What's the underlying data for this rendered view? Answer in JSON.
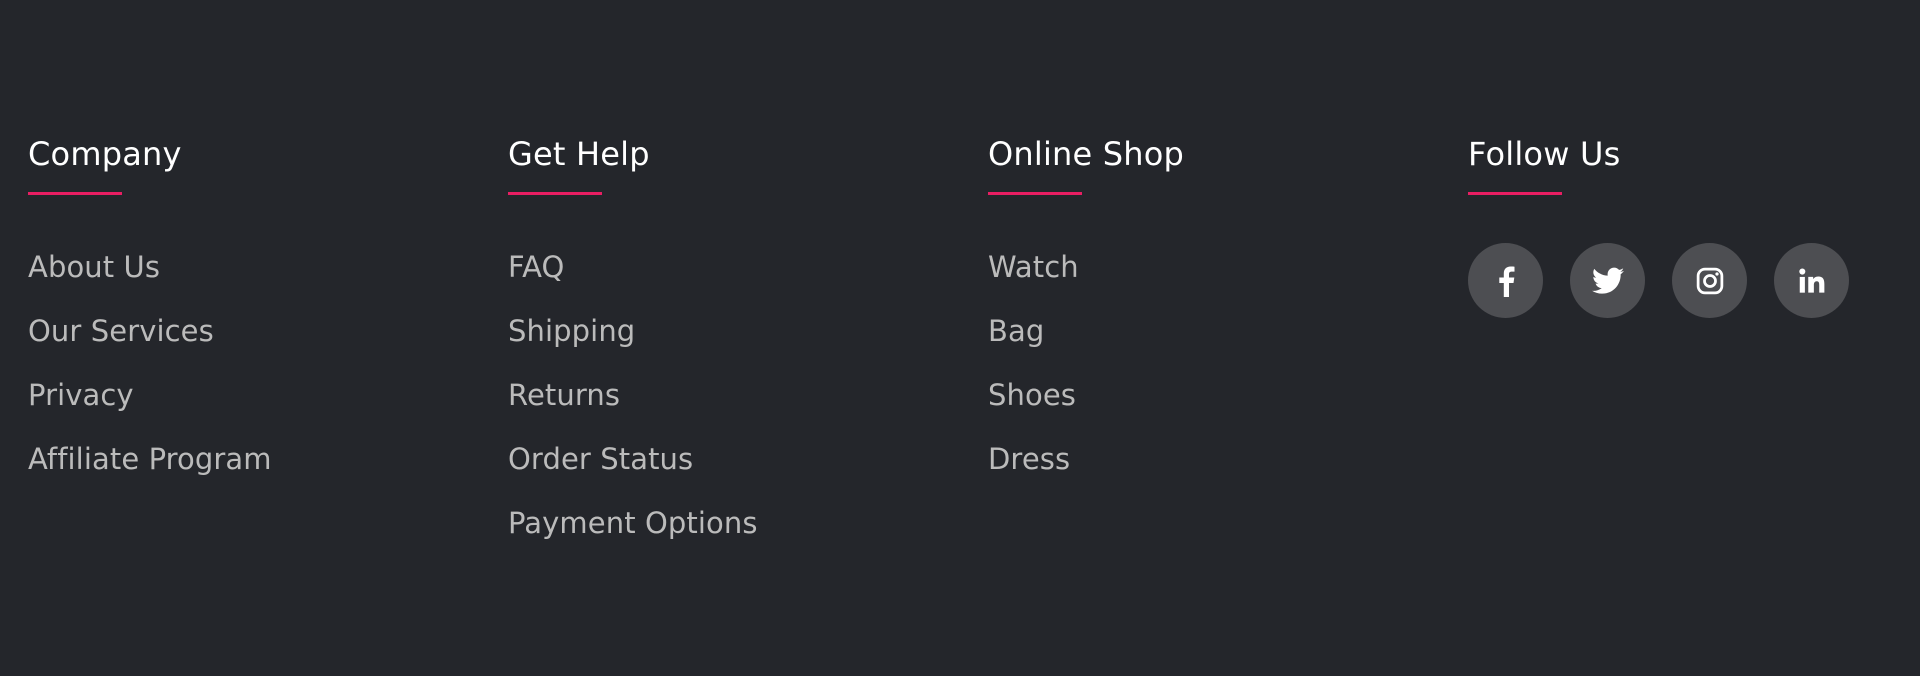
{
  "colors": {
    "background": "#24262b",
    "accent": "#e91e63",
    "heading": "#ffffff",
    "link": "#bbbbbb",
    "social_button_bg": "#4d4e52"
  },
  "footer": {
    "columns": [
      {
        "title": "Company",
        "links": [
          "About Us",
          "Our Services",
          "Privacy",
          "Affiliate Program"
        ]
      },
      {
        "title": "Get Help",
        "links": [
          "FAQ",
          "Shipping",
          "Returns",
          "Order Status",
          "Payment Options"
        ]
      },
      {
        "title": "Online Shop",
        "links": [
          "Watch",
          "Bag",
          "Shoes",
          "Dress"
        ]
      }
    ],
    "follow": {
      "title": "Follow Us",
      "icons": [
        "facebook-icon",
        "twitter-icon",
        "instagram-icon",
        "linkedin-icon"
      ]
    }
  }
}
